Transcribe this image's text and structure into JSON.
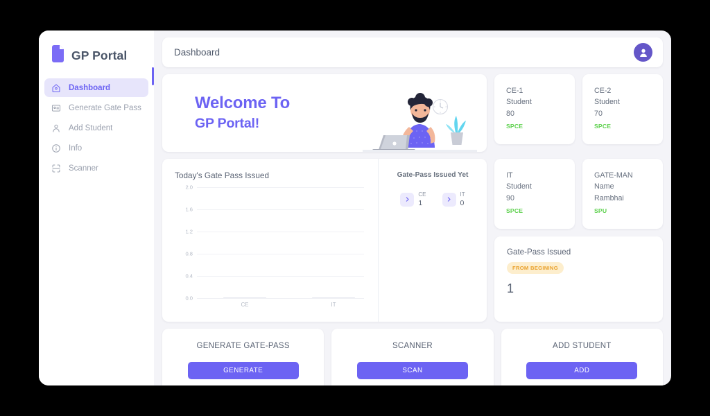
{
  "theme": {
    "accent": "#6c63f3",
    "accent_soft": "#e7e5fb",
    "page_bg": "#f4f4f8",
    "card_bg": "#ffffff",
    "text_muted": "#9aa0ae",
    "text_dark": "#5a6374",
    "green": "#5ed14e",
    "amber_bg": "#fdeecd",
    "amber_fg": "#e9a02a",
    "outer_bg": "#000000"
  },
  "sidebar": {
    "brand": {
      "name": "GP Portal",
      "icon": "file-document-icon"
    },
    "items": [
      {
        "label": "Dashboard",
        "icon": "home-icon",
        "active": true
      },
      {
        "label": "Generate Gate Pass",
        "icon": "id-card-icon",
        "active": false
      },
      {
        "label": "Add Student",
        "icon": "user-icon",
        "active": false
      },
      {
        "label": "Info",
        "icon": "info-circle-icon",
        "active": false
      },
      {
        "label": "Scanner",
        "icon": "scan-frame-icon",
        "active": false
      }
    ]
  },
  "topbar": {
    "title": "Dashboard",
    "avatar_icon": "user-avatar-icon"
  },
  "hero": {
    "line1": "Welcome To",
    "line2": "GP Portal!",
    "illustration": "man-with-laptop-illustration"
  },
  "stats": [
    {
      "title": "CE-1",
      "subtitle": "Student",
      "value": "80",
      "tag": "SPCE"
    },
    {
      "title": "CE-2",
      "subtitle": "Student",
      "value": "70",
      "tag": "SPCE"
    },
    {
      "title": "IT",
      "subtitle": "Student",
      "value": "90",
      "tag": "SPCE"
    },
    {
      "title": "GATE-MAN",
      "subtitle": "Name",
      "value": "Rambhai",
      "tag": "SPU"
    }
  ],
  "issued_total": {
    "title": "Gate-Pass Issued",
    "badge": "FROM BEGINING",
    "value": "1"
  },
  "issued_yet": {
    "title": "Gate-Pass Issued Yet",
    "items": [
      {
        "icon": "chevron-right-icon",
        "label": "CE",
        "value": "1"
      },
      {
        "icon": "chevron-right-icon",
        "label": "IT",
        "value": "0"
      }
    ]
  },
  "actions": [
    {
      "title": "GENERATE GATE-PASS",
      "button": "GENERATE"
    },
    {
      "title": "SCANNER",
      "button": "SCAN"
    },
    {
      "title": "ADD STUDENT",
      "button": "ADD"
    }
  ],
  "chart_data": {
    "type": "bar",
    "title": "Today's Gate Pass Issued",
    "categories": [
      "CE",
      "IT"
    ],
    "values": [
      0,
      0
    ],
    "xlabel": "",
    "ylabel": "",
    "ylim": [
      0.0,
      2.0
    ],
    "yticks": [
      "2.0",
      "1.6",
      "1.2",
      "0.8",
      "0.4",
      "0.0"
    ],
    "grid": true,
    "legend": "none",
    "bar_color": "#e4e6ee"
  }
}
